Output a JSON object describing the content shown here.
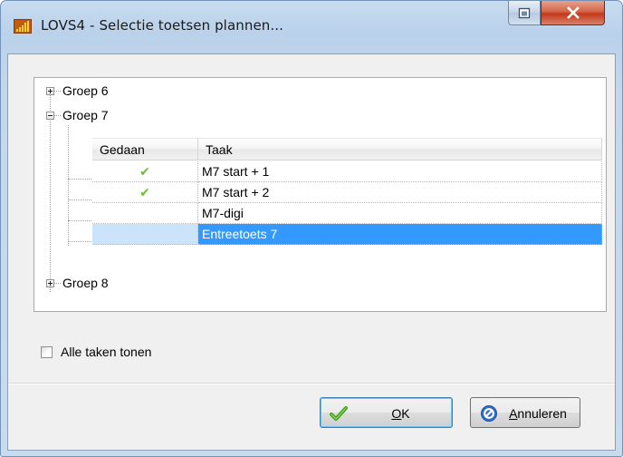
{
  "window": {
    "title": "LOVS4 - Selectie toetsen plannen...",
    "close_symbol": "X"
  },
  "tree": {
    "groups": [
      {
        "label": "Groep 6",
        "expanded": false
      },
      {
        "label": "Groep 7",
        "expanded": true
      },
      {
        "label": "Groep 8",
        "expanded": false
      }
    ],
    "grid": {
      "columns": [
        "Gedaan",
        "Taak"
      ],
      "rows": [
        {
          "done": true,
          "task": "M7 start + 1",
          "selected": false
        },
        {
          "done": true,
          "task": "M7 start + 2",
          "selected": false
        },
        {
          "done": false,
          "task": "M7-digi",
          "selected": false
        },
        {
          "done": false,
          "task": "Entreetoets 7",
          "selected": true
        }
      ],
      "check_glyph": "✔"
    }
  },
  "options": {
    "show_all_label": "Alle taken tonen",
    "show_all_checked": false
  },
  "buttons": {
    "ok_mnemonic": "O",
    "ok_rest": "K",
    "cancel_mnemonic": "A",
    "cancel_rest": "nnuleren"
  },
  "colors": {
    "selection": "#3399ff",
    "selection_inactive": "#cce4fb",
    "check": "#6dbd2e",
    "close_button": "#c4381c"
  }
}
